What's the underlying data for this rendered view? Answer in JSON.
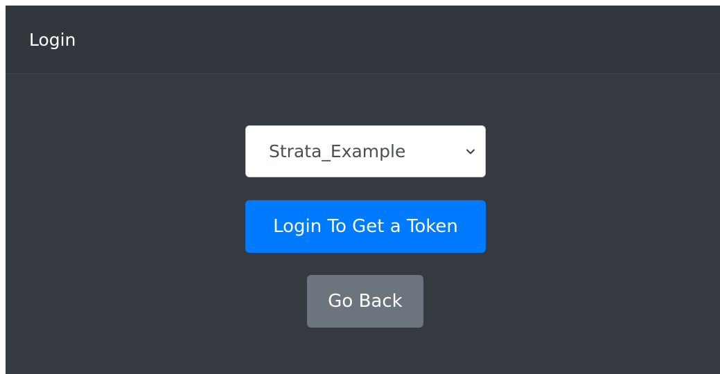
{
  "header": {
    "title": "Login"
  },
  "login_form": {
    "account_select": {
      "selected_value": "Strata_Example",
      "icon": "chevron-down-icon"
    },
    "login_button_label": "Login To Get a Token",
    "go_back_button_label": "Go Back"
  },
  "colors": {
    "background": "#343a40",
    "primary": "#007bff",
    "secondary": "#6c757d"
  }
}
